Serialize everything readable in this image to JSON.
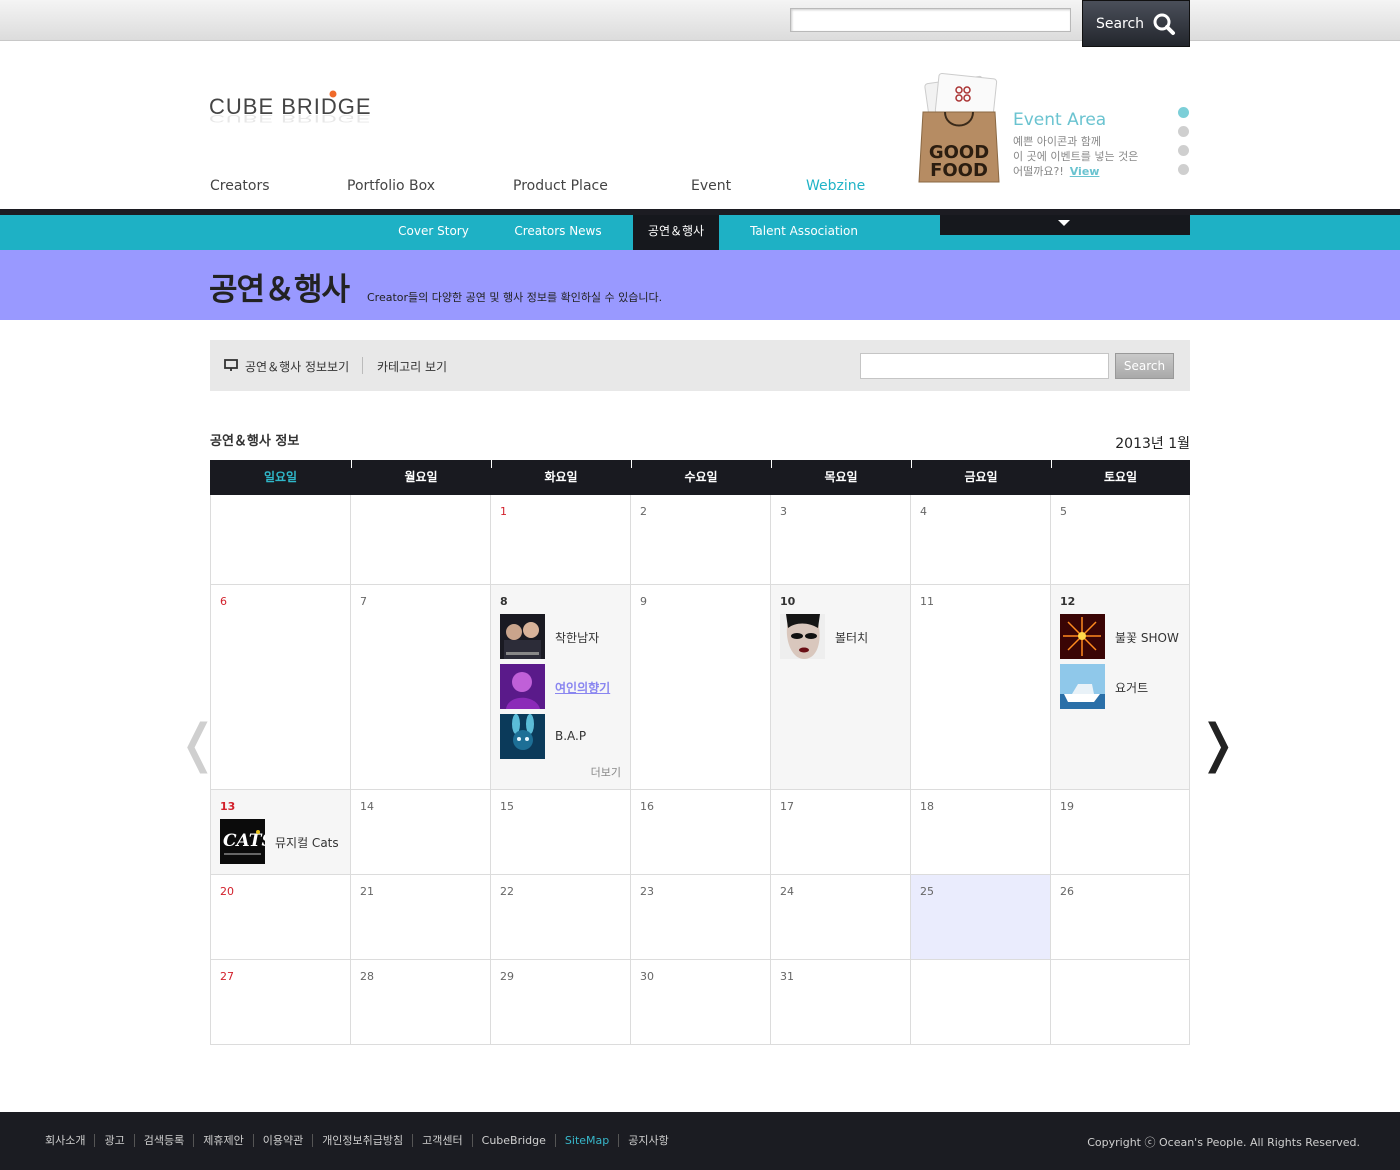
{
  "topbar": {
    "search_button": "Search",
    "search_icon": "search-icon"
  },
  "logo": {
    "text": "CUBE BRIDGE"
  },
  "main_nav": [
    {
      "label": "Creators",
      "active": false
    },
    {
      "label": "Portfolio Box",
      "active": false
    },
    {
      "label": "Product Place",
      "active": false
    },
    {
      "label": "Event",
      "active": false
    },
    {
      "label": "Webzine",
      "active": true
    }
  ],
  "event_area": {
    "title": "Event Area",
    "line1": "예쁜 아이콘과 함께",
    "line2": "이 곳에 이벤트를 넣는 것은",
    "line3": "어떨까요?!",
    "view_link": "View",
    "bag_text1": "GOOD",
    "bag_text2": "FOOD",
    "pager_count": 4,
    "pager_active": 0
  },
  "sub_nav": [
    {
      "label": "Cover Story",
      "active": false
    },
    {
      "label": "Creators News",
      "active": false
    },
    {
      "label": "공연＆행사",
      "active": true
    },
    {
      "label": "Talent Association",
      "active": false
    }
  ],
  "banner": {
    "title": "공연＆행사",
    "description": "Creator들의 다양한 공연 및 행사 정보를 확인하실 수 있습니다."
  },
  "toolbar": {
    "link1": "공연＆행사 정보보기",
    "link2": "카테고리 보기",
    "search_button": "Search"
  },
  "calendar": {
    "section_title": "공연＆행사 정보",
    "month_label": "2013년  1월",
    "day_names": [
      "일요일",
      "월요일",
      "화요일",
      "수요일",
      "목요일",
      "금요일",
      "토요일"
    ],
    "more_label": "더보기",
    "weeks": [
      [
        null,
        null,
        {
          "day": "1",
          "red": true
        },
        {
          "day": "2"
        },
        {
          "day": "3"
        },
        {
          "day": "4"
        },
        {
          "day": "5"
        }
      ],
      [
        {
          "day": "6",
          "red": true
        },
        {
          "day": "7"
        },
        {
          "day": "8",
          "events": [
            {
              "title": "착한남자",
              "thumb": "drama-poster"
            },
            {
              "title": "여인의향기",
              "thumb": "purple-portrait",
              "link": true
            },
            {
              "title": "B.A.P",
              "thumb": "blue-rabbit"
            }
          ],
          "more": true
        },
        {
          "day": "9"
        },
        {
          "day": "10",
          "events": [
            {
              "title": "볼터치",
              "thumb": "makeup-face"
            }
          ]
        },
        {
          "day": "11"
        },
        {
          "day": "12",
          "events": [
            {
              "title": "불꽃 SHOW",
              "thumb": "fireworks"
            },
            {
              "title": "요거트",
              "thumb": "boat"
            }
          ]
        }
      ],
      [
        {
          "day": "13",
          "red": true,
          "events": [
            {
              "title": "뮤지컬 Cats",
              "thumb": "cats-logo"
            }
          ]
        },
        {
          "day": "14"
        },
        {
          "day": "15"
        },
        {
          "day": "16"
        },
        {
          "day": "17"
        },
        {
          "day": "18"
        },
        {
          "day": "19"
        }
      ],
      [
        {
          "day": "20",
          "red": true
        },
        {
          "day": "21"
        },
        {
          "day": "22"
        },
        {
          "day": "23"
        },
        {
          "day": "24"
        },
        {
          "day": "25",
          "today": true
        },
        {
          "day": "26"
        }
      ],
      [
        {
          "day": "27",
          "red": true
        },
        {
          "day": "28"
        },
        {
          "day": "29"
        },
        {
          "day": "30"
        },
        {
          "day": "31"
        },
        null,
        null
      ]
    ]
  },
  "footer": {
    "links": [
      {
        "label": "회사소개"
      },
      {
        "label": "광고"
      },
      {
        "label": "검색등록"
      },
      {
        "label": "제휴제안"
      },
      {
        "label": "이용약관"
      },
      {
        "label": "개인정보취급방침"
      },
      {
        "label": "고객센터"
      },
      {
        "label": "CubeBridge"
      },
      {
        "label": "SiteMap",
        "highlight": true
      },
      {
        "label": "공지사항"
      }
    ],
    "copyright": "Copyright ⓒ Ocean's People. All Rights Reserved."
  },
  "colors": {
    "accent_cyan": "#1eb1c5",
    "banner_purple": "#9999ff",
    "dark": "#191a20",
    "holiday_red": "#d2202b",
    "today_bg": "#eaecfd"
  }
}
